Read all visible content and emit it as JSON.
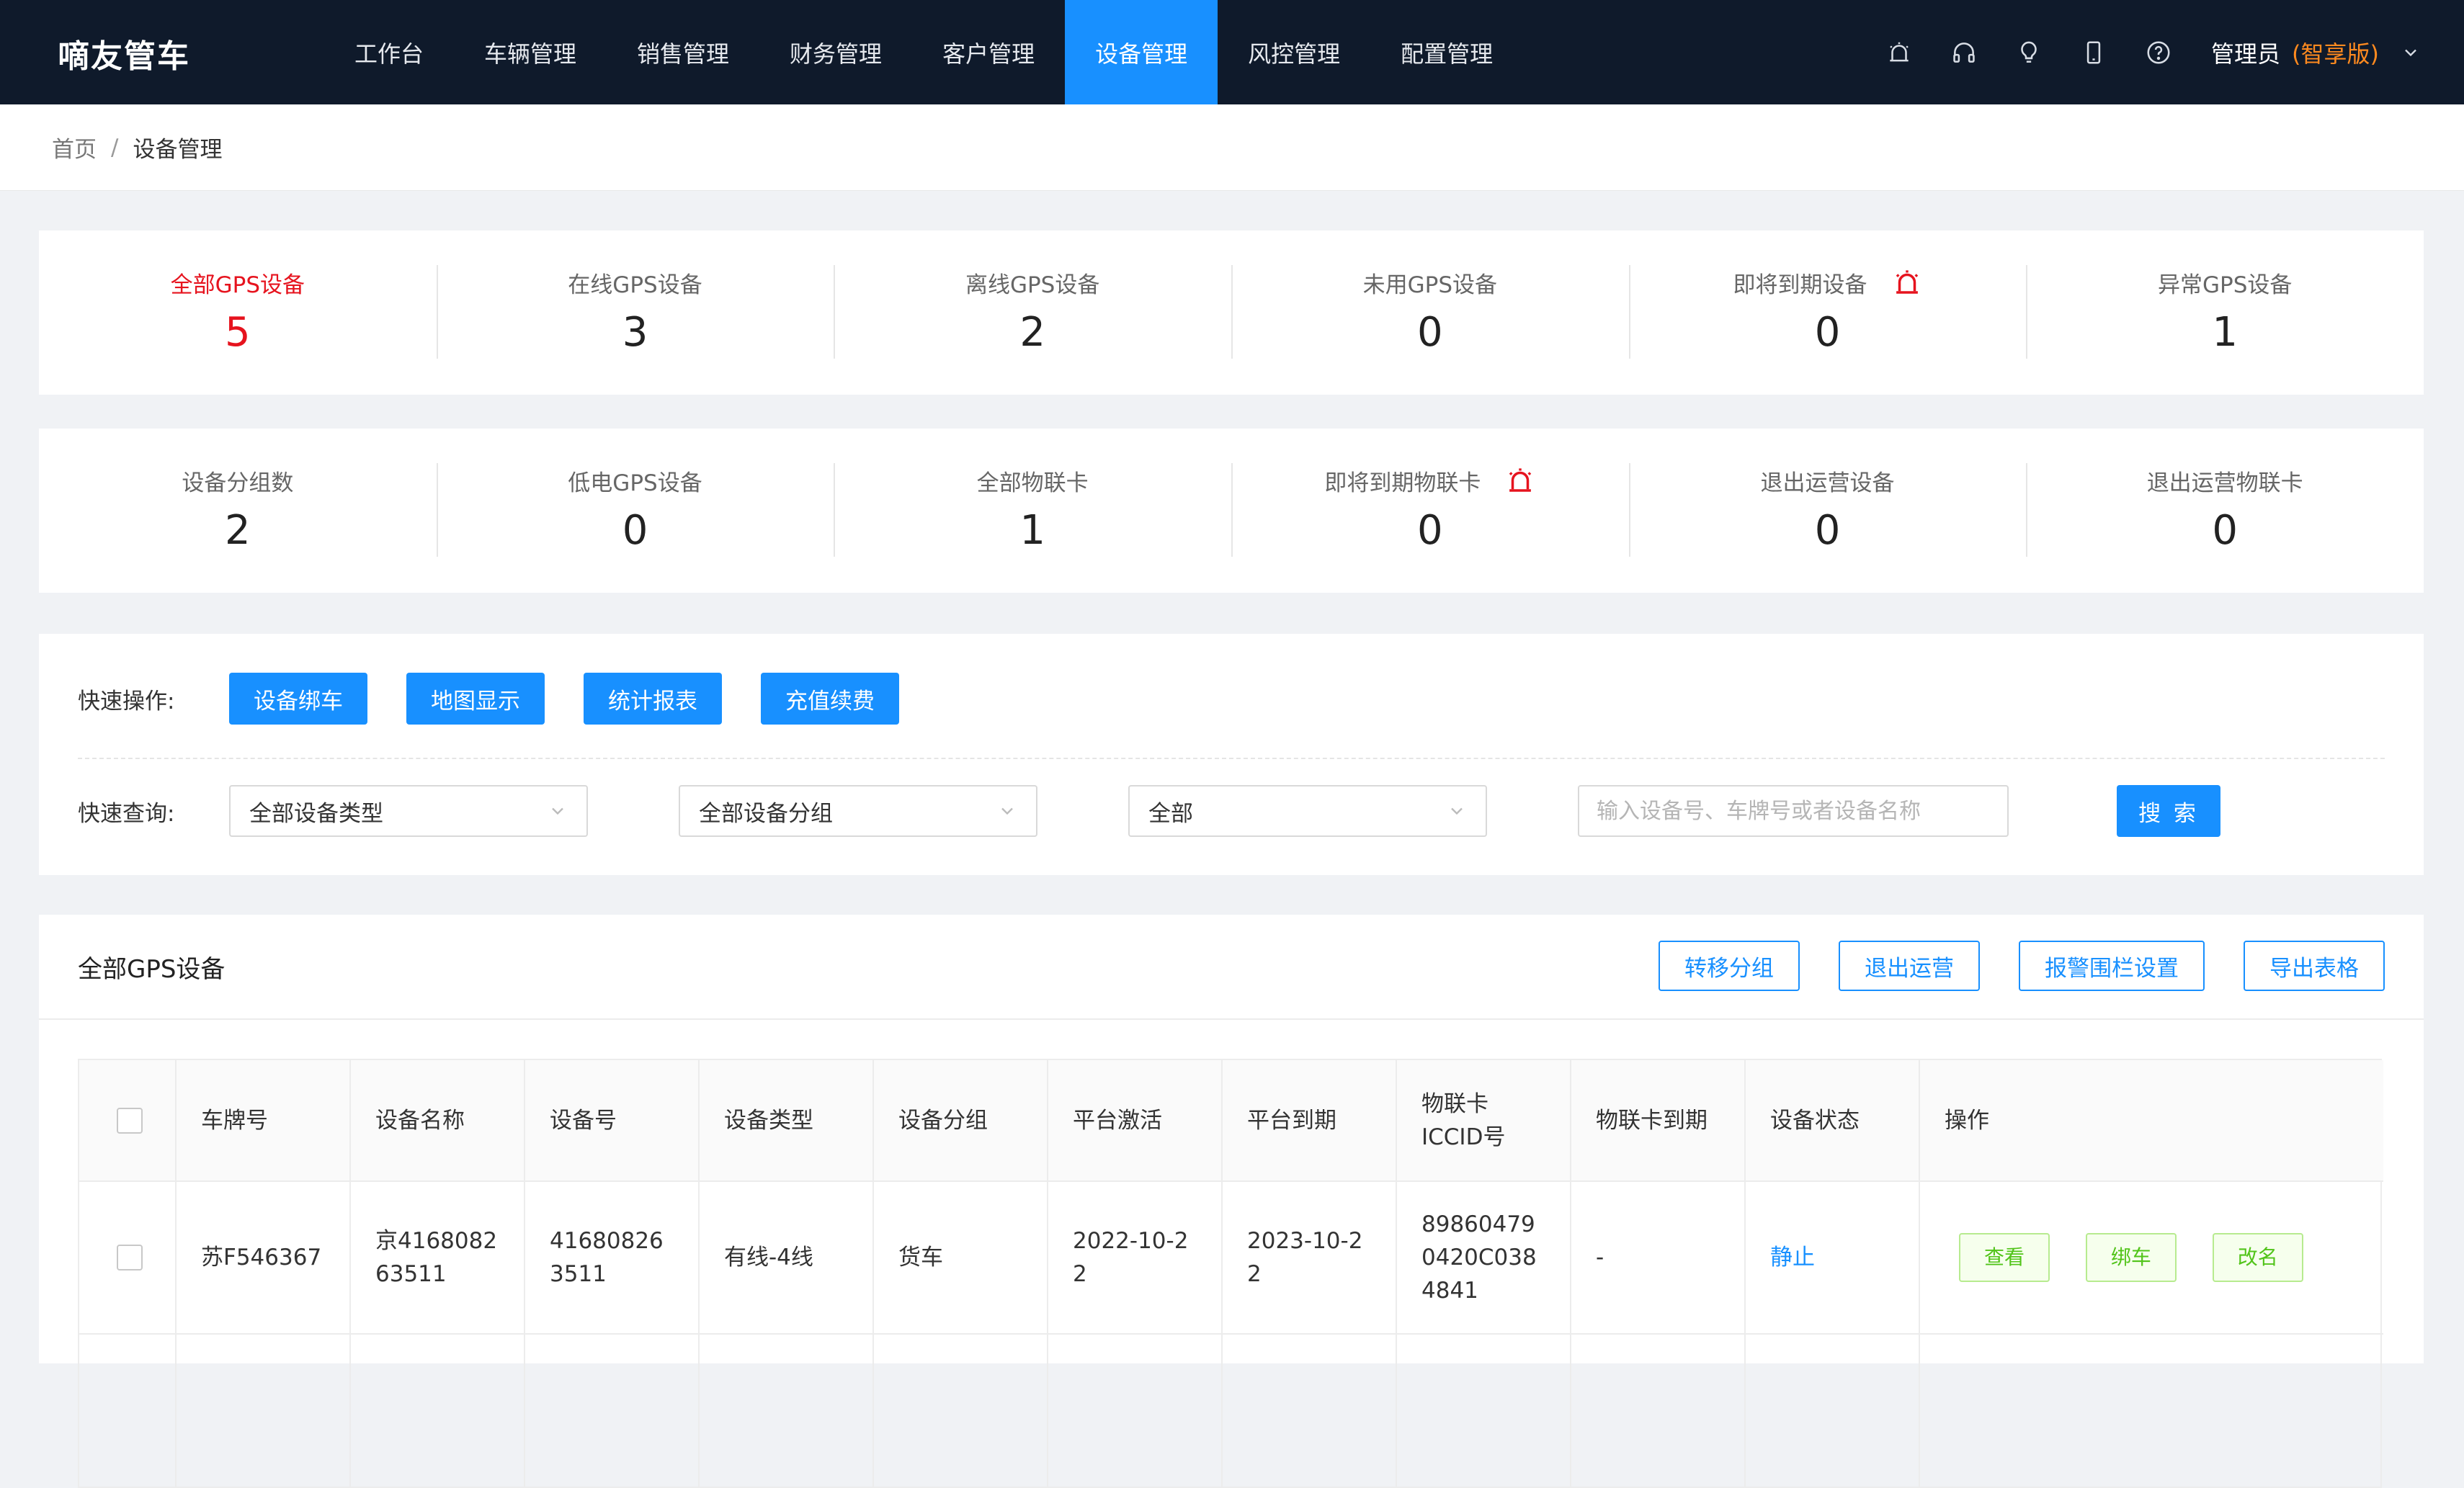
{
  "app": {
    "brand": "嘀友管车"
  },
  "nav": {
    "items": [
      {
        "label": "工作台"
      },
      {
        "label": "车辆管理"
      },
      {
        "label": "销售管理"
      },
      {
        "label": "财务管理"
      },
      {
        "label": "客户管理"
      },
      {
        "label": "设备管理",
        "active": true
      },
      {
        "label": "风控管理"
      },
      {
        "label": "配置管理"
      }
    ],
    "right_icons": [
      "alarm-icon",
      "headset-icon",
      "bulb-icon",
      "mobile-icon",
      "help-icon"
    ],
    "user": {
      "name": "管理员",
      "edition": "(智享版)"
    }
  },
  "breadcrumb": {
    "home": "首页",
    "separator": "/",
    "current": "设备管理"
  },
  "stats_row1": [
    {
      "label": "全部GPS设备",
      "value": "5",
      "active": true
    },
    {
      "label": "在线GPS设备",
      "value": "3"
    },
    {
      "label": "离线GPS设备",
      "value": "2"
    },
    {
      "label": "未用GPS设备",
      "value": "0"
    },
    {
      "label": "即将到期设备",
      "value": "0",
      "alarm": true
    },
    {
      "label": "异常GPS设备",
      "value": "1"
    }
  ],
  "stats_row2": [
    {
      "label": "设备分组数",
      "value": "2"
    },
    {
      "label": "低电GPS设备",
      "value": "0"
    },
    {
      "label": "全部物联卡",
      "value": "1"
    },
    {
      "label": "即将到期物联卡",
      "value": "0",
      "alarm": true
    },
    {
      "label": "退出运营设备",
      "value": "0"
    },
    {
      "label": "退出运营物联卡",
      "value": "0"
    }
  ],
  "quick_ops": {
    "label": "快速操作:",
    "buttons": [
      "设备绑车",
      "地图显示",
      "统计报表",
      "充值续费"
    ]
  },
  "quick_query": {
    "label": "快速查询:",
    "device_type": "全部设备类型",
    "device_group": "全部设备分组",
    "status": "全部",
    "search_placeholder": "输入设备号、车牌号或者设备名称",
    "search_button": "搜 索"
  },
  "list": {
    "title": "全部GPS设备",
    "actions": [
      "转移分组",
      "退出运营",
      "报警围栏设置",
      "导出表格"
    ],
    "columns": [
      "车牌号",
      "设备名称",
      "设备号",
      "设备类型",
      "设备分组",
      "平台激活",
      "平台到期",
      "物联卡ICCID号",
      "物联卡到期",
      "设备状态",
      "操作"
    ],
    "rows": [
      {
        "plate": "苏F546367",
        "device_name": "京416808263511",
        "device_no": "416808263511",
        "device_type": "有线-4线",
        "device_group": "货车",
        "activated": "2022-10-22",
        "expires": "2023-10-22",
        "iccid": "898604790420C0384841",
        "card_expires": "-",
        "status": "静止",
        "ops": [
          "查看",
          "绑车",
          "改名"
        ]
      }
    ]
  },
  "colors": {
    "nav_bg": "#0f1a2b",
    "accent": "#1890ff",
    "active_stat": "#e6131e",
    "edition": "#ff8a1f",
    "op_green": "#52c41a"
  }
}
